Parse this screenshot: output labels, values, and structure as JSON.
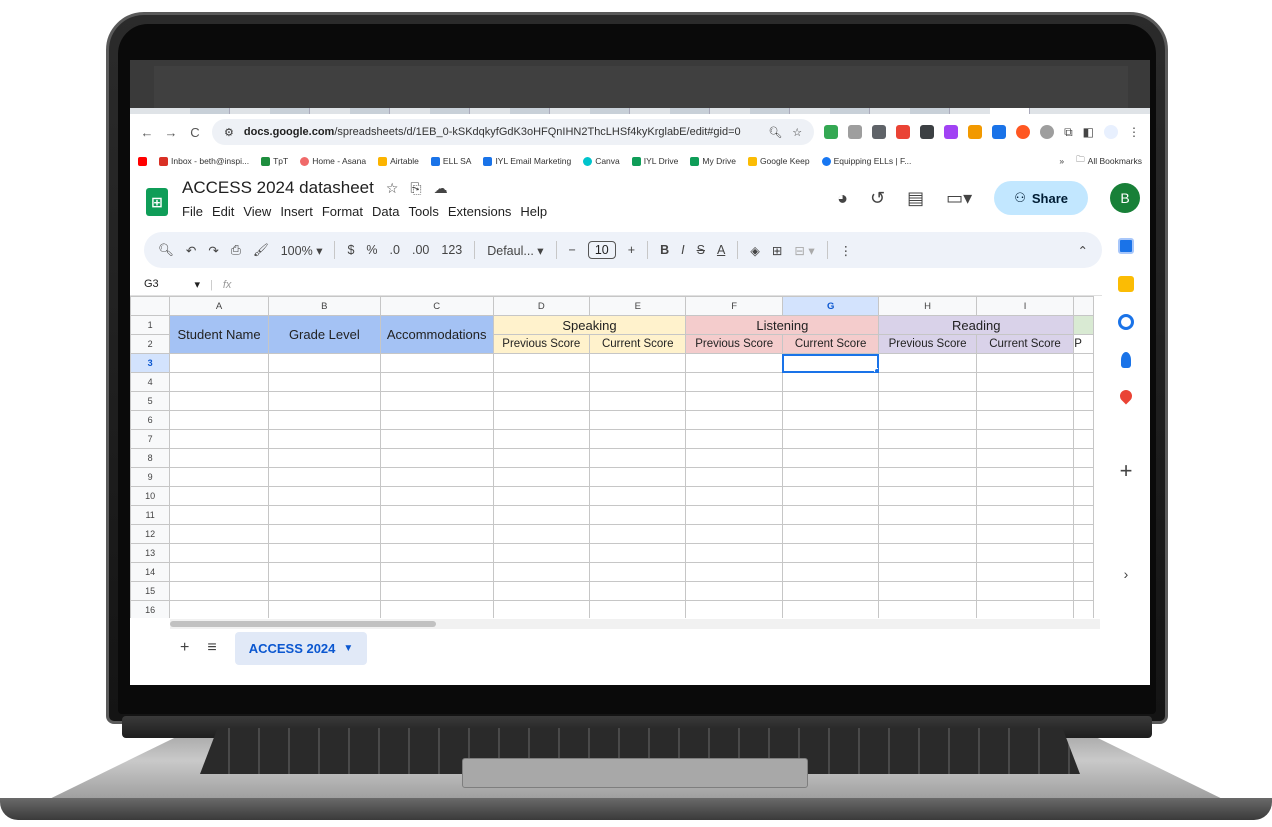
{
  "browser": {
    "nav": {
      "back": "←",
      "forward": "→",
      "reload": "C"
    },
    "url_host": "docs.google.com",
    "url_path": "/spreadsheets/d/1EB_0-kSKdqkyfGdK3oHFQnIHN2ThcLHSf4kyKrglabE/edit#gid=0",
    "bookmarks": [
      {
        "label": "Inbox - beth@inspi...",
        "color": "#d93025"
      },
      {
        "label": "TpT",
        "color": "#1e8e3e"
      },
      {
        "label": "Home - Asana",
        "color": "#f06a6a"
      },
      {
        "label": "Airtable",
        "color": "#fcb400"
      },
      {
        "label": "ELL SA",
        "color": "#1a73e8"
      },
      {
        "label": "IYL Email Marketing",
        "color": "#1a73e8"
      },
      {
        "label": "Canva",
        "color": "#00c4cc"
      },
      {
        "label": "IYL Drive",
        "color": "#0f9d58"
      },
      {
        "label": "My Drive",
        "color": "#0f9d58"
      },
      {
        "label": "Google Keep",
        "color": "#fbbc04"
      },
      {
        "label": "Equipping ELLs | F...",
        "color": "#1877f2"
      }
    ],
    "bookmarks_overflow": "»",
    "all_bookmarks": "All Bookmarks"
  },
  "sheets": {
    "title": "ACCESS 2024 datasheet",
    "menu": [
      "File",
      "Edit",
      "View",
      "Insert",
      "Format",
      "Data",
      "Tools",
      "Extensions",
      "Help"
    ],
    "share_label": "Share",
    "avatar_letter": "B",
    "toolbar": {
      "zoom": "100%",
      "currency": "$",
      "percent": "%",
      "dec_decrease": ".0",
      "dec_increase": ".00",
      "number_format": "123",
      "font": "Defaul...",
      "minus": "−",
      "font_size": "10",
      "plus": "+",
      "bold": "B",
      "italic": "I",
      "strike": "S",
      "text_color": "A",
      "more": "⋮"
    },
    "cell_ref": "G3",
    "fx": "fx",
    "columns": [
      "A",
      "B",
      "C",
      "D",
      "E",
      "F",
      "G",
      "H",
      "I"
    ],
    "selected_column": "G",
    "selected_row": "3",
    "headers": {
      "student_name": "Student Name",
      "grade_level": "Grade Level",
      "accommodations": "Accommodations",
      "speaking": "Speaking",
      "listening": "Listening",
      "reading": "Reading",
      "previous_score": "Previous Score",
      "current_score": "Current Score",
      "partial": "P"
    },
    "row_numbers": [
      "1",
      "2",
      "3",
      "4",
      "5",
      "6",
      "7",
      "8",
      "9",
      "10",
      "11",
      "12",
      "13",
      "14",
      "15",
      "16"
    ],
    "sheet_tab": "ACCESS 2024",
    "colors": {
      "blue_header": "#a4c2f4",
      "speaking": "#fff2cc",
      "listening": "#f4cccc",
      "reading": "#d9d2e9",
      "writing": "#d9ead3",
      "share_bg": "#c2e7ff",
      "sheets_green": "#0f9d58"
    }
  }
}
